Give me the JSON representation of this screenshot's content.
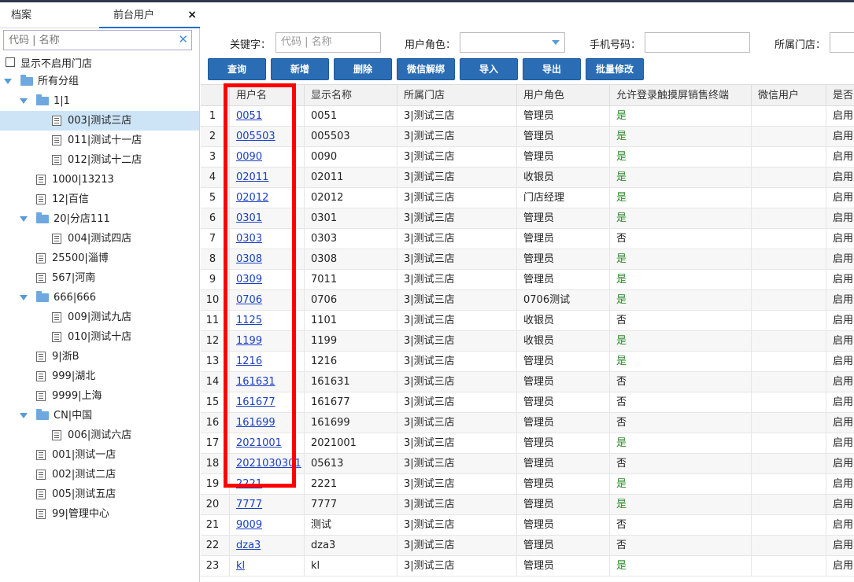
{
  "tabs": [
    {
      "label": "档案"
    },
    {
      "label": "前台用户",
      "close": "×"
    }
  ],
  "sidebar": {
    "search_placeholder": "代码 | 名称",
    "clear_icon": "✕",
    "show_disabled_label": "显示不启用门店",
    "tree": [
      {
        "label": "所有分组",
        "type": "folder",
        "level": 0,
        "expanded": true
      },
      {
        "label": "1|1",
        "type": "folder",
        "level": 1,
        "expanded": true
      },
      {
        "label": "003|测试三店",
        "type": "doc",
        "level": 2,
        "selected": true
      },
      {
        "label": "011|测试十一店",
        "type": "doc",
        "level": 2
      },
      {
        "label": "012|测试十二店",
        "type": "doc",
        "level": 2
      },
      {
        "label": "1000|13213",
        "type": "doc",
        "level": 1
      },
      {
        "label": "12|百信",
        "type": "doc",
        "level": 1
      },
      {
        "label": "20|分店111",
        "type": "folder",
        "level": 1,
        "expanded": true
      },
      {
        "label": "004|测试四店",
        "type": "doc",
        "level": 2
      },
      {
        "label": "25500|淄博",
        "type": "doc",
        "level": 1
      },
      {
        "label": "567|河南",
        "type": "doc",
        "level": 1
      },
      {
        "label": "666|666",
        "type": "folder",
        "level": 1,
        "expanded": true
      },
      {
        "label": "009|测试九店",
        "type": "doc",
        "level": 2
      },
      {
        "label": "010|测试十店",
        "type": "doc",
        "level": 2
      },
      {
        "label": "9|浙B",
        "type": "doc",
        "level": 1
      },
      {
        "label": "999|湖北",
        "type": "doc",
        "level": 1
      },
      {
        "label": "9999|上海",
        "type": "doc",
        "level": 1
      },
      {
        "label": "CN|中国",
        "type": "folder",
        "level": 1,
        "expanded": true
      },
      {
        "label": "006|测试六店",
        "type": "doc",
        "level": 2
      },
      {
        "label": "001|测试一店",
        "type": "doc",
        "level": 1
      },
      {
        "label": "002|测试二店",
        "type": "doc",
        "level": 1
      },
      {
        "label": "005|测试五店",
        "type": "doc",
        "level": 1
      },
      {
        "label": "99|管理中心",
        "type": "doc",
        "level": 1
      }
    ]
  },
  "filters": {
    "keyword_label": "关键字：",
    "keyword_placeholder": "代码 | 名称",
    "role_label": "用户角色：",
    "role_value": "",
    "phone_label": "手机号码：",
    "phone_value": "",
    "store_label": "所属门店："
  },
  "buttons": [
    "查询",
    "新增",
    "删除",
    "微信解绑",
    "导入",
    "导出",
    "批量修改"
  ],
  "grid": {
    "columns": [
      "",
      "用户名",
      "显示名称",
      "所属门店",
      "用户角色",
      "允许登录触摸屏销售终端",
      "微信用户",
      "是否"
    ],
    "rows": [
      [
        "1",
        "0051",
        "0051",
        "3|测试三店",
        "管理员",
        "是",
        "",
        "启用"
      ],
      [
        "2",
        "005503",
        "005503",
        "3|测试三店",
        "管理员",
        "是",
        "",
        "启用"
      ],
      [
        "3",
        "0090",
        "0090",
        "3|测试三店",
        "管理员",
        "是",
        "",
        "启用"
      ],
      [
        "4",
        "02011",
        "02011",
        "3|测试三店",
        "收银员",
        "是",
        "",
        "启用"
      ],
      [
        "5",
        "02012",
        "02012",
        "3|测试三店",
        "门店经理",
        "是",
        "",
        "启用"
      ],
      [
        "6",
        "0301",
        "0301",
        "3|测试三店",
        "管理员",
        "是",
        "",
        "启用"
      ],
      [
        "7",
        "0303",
        "0303",
        "3|测试三店",
        "管理员",
        "否",
        "",
        "启用"
      ],
      [
        "8",
        "0308",
        "0308",
        "3|测试三店",
        "管理员",
        "是",
        "",
        "启用"
      ],
      [
        "9",
        "0309",
        "7011",
        "3|测试三店",
        "管理员",
        "是",
        "",
        "启用"
      ],
      [
        "10",
        "0706",
        "0706",
        "3|测试三店",
        "0706测试",
        "是",
        "",
        "启用"
      ],
      [
        "11",
        "1125",
        "1101",
        "3|测试三店",
        "收银员",
        "否",
        "",
        "启用"
      ],
      [
        "12",
        "1199",
        "1199",
        "3|测试三店",
        "收银员",
        "是",
        "",
        "启用"
      ],
      [
        "13",
        "1216",
        "1216",
        "3|测试三店",
        "管理员",
        "是",
        "",
        "启用"
      ],
      [
        "14",
        "161631",
        "161631",
        "3|测试三店",
        "管理员",
        "否",
        "",
        "启用"
      ],
      [
        "15",
        "161677",
        "161677",
        "3|测试三店",
        "管理员",
        "否",
        "",
        "启用"
      ],
      [
        "16",
        "161699",
        "161699",
        "3|测试三店",
        "管理员",
        "否",
        "",
        "启用"
      ],
      [
        "17",
        "2021001",
        "2021001",
        "3|测试三店",
        "管理员",
        "是",
        "",
        "启用"
      ],
      [
        "18",
        "2021030301",
        "05613",
        "3|测试三店",
        "管理员",
        "否",
        "",
        "启用"
      ],
      [
        "19",
        "2221",
        "2221",
        "3|测试三店",
        "管理员",
        "是",
        "",
        "启用"
      ],
      [
        "20",
        "7777",
        "7777",
        "3|测试三店",
        "管理员",
        "是",
        "",
        "启用"
      ],
      [
        "21",
        "9009",
        "测试",
        "3|测试三店",
        "管理员",
        "否",
        "",
        "启用"
      ],
      [
        "22",
        "dza3",
        "dza3",
        "3|测试三店",
        "管理员",
        "否",
        "",
        "启用"
      ],
      [
        "23",
        "kl",
        "kl",
        "3|测试三店",
        "管理员",
        "是",
        "",
        "启用"
      ]
    ]
  },
  "colors": {
    "accent": "#2a6db5",
    "link": "#1a3fc4",
    "yes": "#2a8a2a",
    "highlight": "#ff0000",
    "selected": "#cde4f7"
  }
}
